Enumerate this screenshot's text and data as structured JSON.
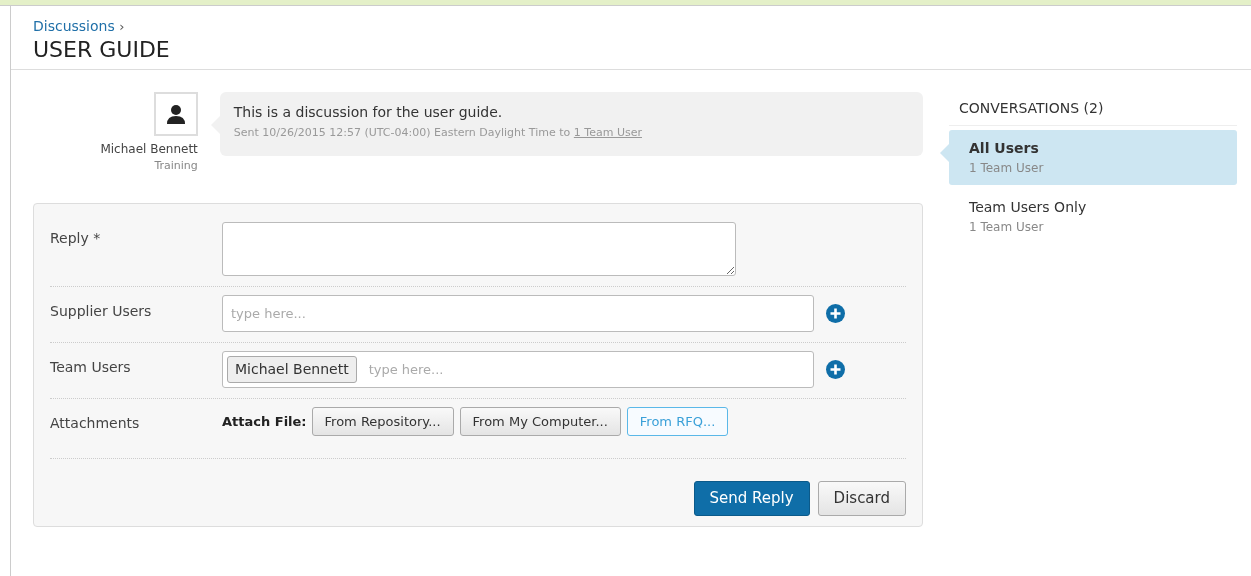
{
  "breadcrumb": {
    "link": "Discussions",
    "separator": "›"
  },
  "title": "USER GUIDE",
  "message": {
    "author": "Michael Bennett",
    "role": "Training",
    "text": "This is a discussion for the user guide.",
    "meta": "Sent 10/26/2015 12:57 (UTC-04:00) Eastern Daylight Time to",
    "recipients_link": "1 Team User"
  },
  "form": {
    "fields": [
      {
        "kind": "textarea",
        "label": "Reply *"
      },
      {
        "kind": "tokens",
        "label": "Supplier Users",
        "placeholder": "type here..."
      },
      {
        "kind": "tokens",
        "label": "Team Users",
        "placeholder": "type here...",
        "tokens": [
          "Michael Bennett"
        ]
      },
      {
        "kind": "attachments",
        "label": "Attachments",
        "prefix": "Attach File:",
        "buttons": [
          {
            "label": "From Repository...",
            "highlighted": false
          },
          {
            "label": "From My Computer...",
            "highlighted": false
          },
          {
            "label": "From RFQ...",
            "highlighted": true
          }
        ]
      }
    ],
    "actions": [
      {
        "label": "Send Reply",
        "kind": "primary"
      },
      {
        "label": "Discard",
        "kind": "secondary"
      }
    ]
  },
  "conversations": {
    "heading": "CONVERSATIONS (2)",
    "items": [
      {
        "name": "All Users",
        "subtitle": "1 Team User",
        "selected": true
      },
      {
        "name": "Team Users Only",
        "subtitle": "1 Team User",
        "selected": false
      }
    ]
  }
}
